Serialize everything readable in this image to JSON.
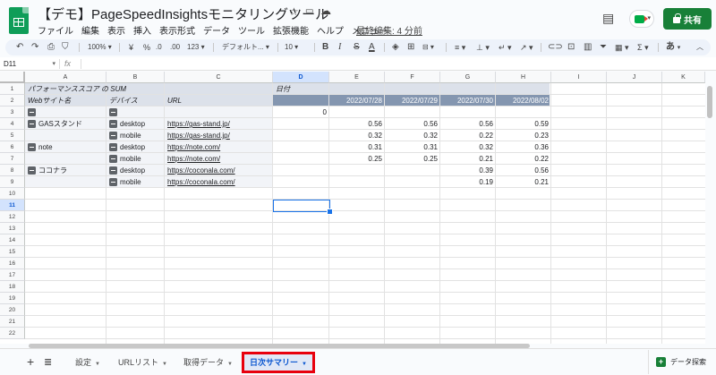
{
  "header": {
    "doc_title": "【デモ】PageSpeedInsightsモニタリングツール",
    "menu": [
      "ファイル",
      "編集",
      "表示",
      "挿入",
      "表示形式",
      "データ",
      "ツール",
      "拡張機能",
      "ヘルプ",
      "メニュー"
    ],
    "last_edit": "最終編集: 4 分前",
    "share_label": "共有",
    "icons": [
      "star-icon",
      "move-to-folder-icon",
      "cloud-saved-icon",
      "comment-icon",
      "meet-icon",
      "share-lock-icon"
    ]
  },
  "toolbar": {
    "zoom": "100%",
    "currency": "¥",
    "percent": "%",
    "decrease_decimal": ".0",
    "increase_decimal": ".00",
    "number_format": "123",
    "font": "デフォルト...",
    "font_size": "10",
    "bold": "B",
    "italic": "I",
    "strike": "S",
    "text_color": "A",
    "input_tool": "あ"
  },
  "formula_bar": {
    "cell_ref": "D11",
    "fx": "fx",
    "value": ""
  },
  "grid": {
    "columns": [
      "A",
      "B",
      "C",
      "D",
      "E",
      "F",
      "G",
      "H",
      "I",
      "J",
      "K"
    ],
    "rows": [
      "1",
      "2",
      "3",
      "4",
      "5",
      "6",
      "7",
      "8",
      "9",
      "10",
      "11",
      "12",
      "13",
      "14",
      "15",
      "16",
      "17",
      "18",
      "19",
      "20",
      "21",
      "22"
    ],
    "r1": {
      "a": "パフォーマンススコア の SUM",
      "d": "日付"
    },
    "r2": {
      "a": "Webサイト名",
      "b": "デバイス",
      "c": "URL",
      "e": "2022/07/28",
      "f": "2022/07/29",
      "g": "2022/07/30",
      "h": "2022/08/02"
    },
    "r3": {
      "d": "0"
    },
    "r4": {
      "a": "GASスタンド",
      "b": "desktop",
      "c": "https://gas-stand.jp/",
      "e": "0.56",
      "f": "0.56",
      "g": "0.56",
      "h": "0.59"
    },
    "r5": {
      "b": "mobile",
      "c": "https://gas-stand.jp/",
      "e": "0.32",
      "f": "0.32",
      "g": "0.22",
      "h": "0.23"
    },
    "r6": {
      "a": "note",
      "b": "desktop",
      "c": "https://note.com/",
      "e": "0.31",
      "f": "0.31",
      "g": "0.32",
      "h": "0.36"
    },
    "r7": {
      "b": "mobile",
      "c": "https://note.com/",
      "e": "0.25",
      "f": "0.25",
      "g": "0.21",
      "h": "0.22"
    },
    "r8": {
      "a": "ココナラ",
      "b": "desktop",
      "c": "https://coconala.com/",
      "g": "0.39",
      "h": "0.56"
    },
    "r9": {
      "b": "mobile",
      "c": "https://coconala.com/",
      "g": "0.19",
      "h": "0.21"
    }
  },
  "sheets": {
    "tabs": [
      "設定",
      "URLリスト",
      "取得データ"
    ],
    "active": "日次サマリー",
    "explore_label": "データ探索"
  },
  "colors": {
    "pivot_header_dark": "#8496b0",
    "pivot_header_light": "#dce1ea",
    "pivot_body": "#f2f4f8",
    "share_green": "#188038",
    "active_tab_highlight": "#e8000d"
  }
}
